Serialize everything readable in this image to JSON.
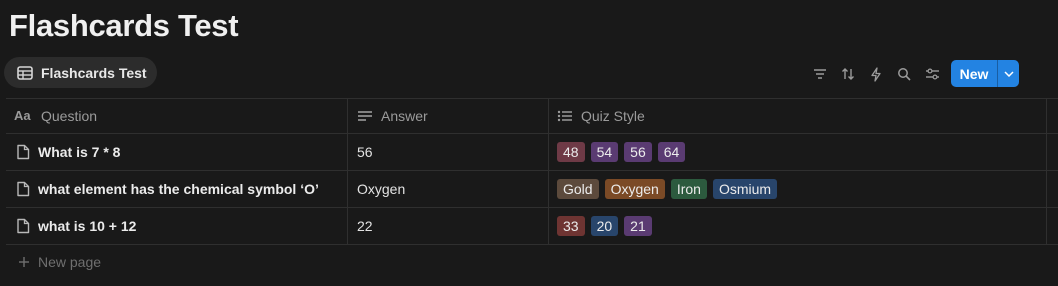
{
  "page": {
    "title": "Flashcards Test"
  },
  "view_tab": {
    "label": "Flashcards Test"
  },
  "toolbar": {
    "new_label": "New",
    "tools": [
      "filter-icon",
      "sort-icon",
      "automation-bolt-icon",
      "search-icon",
      "settings-sliders-icon"
    ],
    "accent": "#2383e2"
  },
  "columns": [
    {
      "label": "Question",
      "icon": "title-aa-icon"
    },
    {
      "label": "Answer",
      "icon": "text-lines-icon"
    },
    {
      "label": "Quiz Style",
      "icon": "multi-select-list-icon"
    }
  ],
  "rows": [
    {
      "question": "What is 7 * 8",
      "answer": "56",
      "tags": [
        {
          "label": "48",
          "color": "#6e3a46"
        },
        {
          "label": "54",
          "color": "#5a3b72"
        },
        {
          "label": "56",
          "color": "#5a3b72"
        },
        {
          "label": "64",
          "color": "#5a3b72"
        }
      ]
    },
    {
      "question": "what element has the chemical symbol ‘O’",
      "answer": "Oxygen",
      "tags": [
        {
          "label": "Gold",
          "color": "#5c4a3c"
        },
        {
          "label": "Oxygen",
          "color": "#7b4a26"
        },
        {
          "label": "Iron",
          "color": "#2c5a3e"
        },
        {
          "label": "Osmium",
          "color": "#28456b"
        }
      ]
    },
    {
      "question": "what is 10 + 12",
      "answer": "22",
      "tags": [
        {
          "label": "33",
          "color": "#6e3432"
        },
        {
          "label": "20",
          "color": "#28456b"
        },
        {
          "label": "21",
          "color": "#5a3b72"
        }
      ]
    }
  ],
  "footer": {
    "new_page_label": "New page"
  }
}
